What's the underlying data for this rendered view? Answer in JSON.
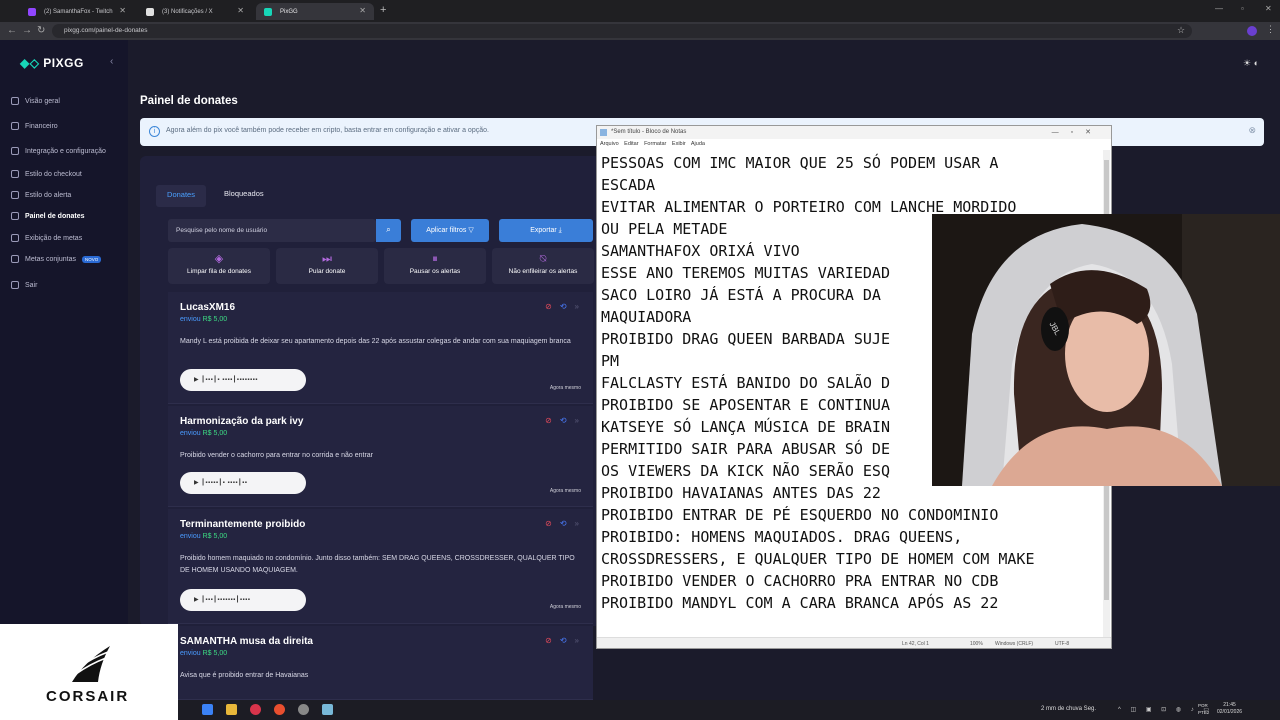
{
  "browser": {
    "tabs": [
      {
        "label": "(2) SamanthaFox - Twitch",
        "color": "#9146ff"
      },
      {
        "label": "(3) Notificações / X",
        "color": "#ffffff"
      },
      {
        "label": "PixGG",
        "color": "#17d6b8"
      }
    ],
    "url": "pixgg.com/painel-de-donates"
  },
  "sidebar": {
    "logo": "PIXGG",
    "items": [
      {
        "label": "Visão geral"
      },
      {
        "label": "Financeiro"
      },
      {
        "label": "Integração e configuração"
      },
      {
        "label": "Estilo do checkout"
      },
      {
        "label": "Estilo do alerta"
      },
      {
        "label": "Painel de donates"
      },
      {
        "label": "Exibição de metas"
      },
      {
        "label": "Metas conjuntas",
        "badge": "NOVO"
      },
      {
        "label": "Sair"
      }
    ]
  },
  "main": {
    "title": "Painel de donates",
    "banner": "Agora além do pix você também pode receber em cripto, basta entrar em configuração e ativar a opção.",
    "tabs": [
      "Donates",
      "Bloqueados"
    ],
    "search_placeholder": "Pesquise pelo nome de usuário",
    "filter_button": "Aplicar filtros",
    "export_button": "Exportar",
    "actions": [
      "Limpar fila de donates",
      "Pular donate",
      "Pausar os alertas",
      "Não enfileirar os alertas"
    ],
    "donations": [
      {
        "name": "LucasXM16",
        "sent": "enviou",
        "amount": "R$ 5,00",
        "message": "Mandy L está proibida de deixar seu apartamento depois das 22 após assustar colegas de andar com sua maquiagem branca",
        "time": "Agora mesmo"
      },
      {
        "name": "Harmonização da park ivy",
        "sent": "enviou",
        "amount": "R$ 5,00",
        "message": "Proibido vender o cachorro para entrar no corrida e não entrar",
        "time": "Agora mesmo"
      },
      {
        "name": "Terminantemente proibido",
        "sent": "enviou",
        "amount": "R$ 5,00",
        "message": "Proibido homem maquiado no condomínio. Junto disso também: SEM DRAG QUEENS, CROSSDRESSER, QUALQUER TIPO DE HOMEM USANDO MAQUIAGEM.",
        "time": "Agora mesmo"
      },
      {
        "name": "SAMANTHA musa da direita",
        "sent": "enviou",
        "amount": "R$ 5,00",
        "message": "Avisa que é proibido entrar de Havaianas",
        "time": ""
      }
    ]
  },
  "notepad": {
    "title": "*Sem título - Bloco de Notas",
    "menu": "Arquivo Editar Formatar Exibir Ajuda",
    "text": "PESSOAS COM IMC MAIOR QUE 25 SÓ PODEM USAR A\nESCADA\nEVITAR ALIMENTAR O PORTEIRO COM LANCHE MORDIDO\nOU PELA METADE\nSAMANTHAFOX ORIXÁ VIVO\nESSE ANO TEREMOS MUITAS VARIEDAD\nSACO LOIRO JÁ ESTÁ A PROCURA DA\nMAQUIADORA\nPROIBIDO DRAG QUEEN BARBADA SUJE\nPM\nFALCLASTY ESTÁ BANIDO DO SALÃO D\nPROIBIDO SE APOSENTAR E CONTINUA\nKATSEYE SÓ LANÇA MÚSICA DE BRAIN\nPERMITIDO SAIR PARA ABUSAR SÓ DE\nOS VIEWERS DA KICK NÃO SERÃO ESQ\nPROIBIDO HAVAIANAS ANTES DAS 22\nPROIBIDO ENTRAR DE PÉ ESQUERDO NO CONDOMINIO\nPROIBIDO: HOMENS MAQUIADOS. DRAG QUEENS,\nCROSSDRESSERS, E QUALQUER TIPO DE HOMEM COM MAKE\nPROIBIDO VENDER O CACHORRO PRA ENTRAR NO CDB\nPROIBIDO MANDYL COM A CARA BRANCA APÓS AS 22",
    "status": {
      "pos": "Ln 42, Col 1",
      "zoom": "100%",
      "eol": "Windows (CRLF)",
      "enc": "UTF-8"
    }
  },
  "overlay": {
    "brand": "CORSAIR",
    "headset": "JBL"
  },
  "taskbar": {
    "weather": "2 mm de chuva Seg.",
    "lang": [
      "POR",
      "PTB2"
    ],
    "time": "21:45",
    "date": "02/01/2026"
  },
  "colors": {
    "accent": "#3a7ed8",
    "amount": "#3ddc84",
    "brand": "#17d6b8"
  }
}
